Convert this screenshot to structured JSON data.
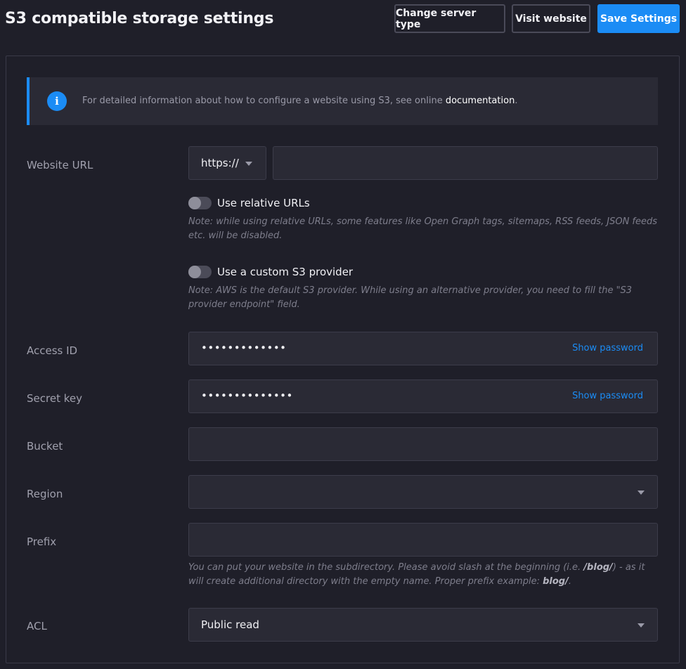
{
  "header": {
    "title": "S3 compatible storage settings",
    "change_server_label": "Change server type",
    "visit_website_label": "Visit website",
    "save_label": "Save Settings"
  },
  "info": {
    "text_before": "For detailed information about how to configure a website using S3, see online ",
    "link_text": "documentation",
    "text_after": "."
  },
  "form": {
    "website_url": {
      "label": "Website URL",
      "protocol": "https://",
      "value": ""
    },
    "relative_urls": {
      "label": "Use relative URLs",
      "enabled": false,
      "note": "Note: while using relative URLs, some features like Open Graph tags, sitemaps, RSS feeds, JSON feeds etc. will be disabled."
    },
    "custom_provider": {
      "label": "Use a custom S3 provider",
      "enabled": false,
      "note": "Note: AWS is the default S3 provider. While using an alternative provider, you need to fill the \"S3 provider endpoint\" field."
    },
    "access_id": {
      "label": "Access ID",
      "masked_value": "•••••••••••••",
      "show_label": "Show password"
    },
    "secret_key": {
      "label": "Secret key",
      "masked_value": "••••••••••••••",
      "show_label": "Show password"
    },
    "bucket": {
      "label": "Bucket",
      "value": ""
    },
    "region": {
      "label": "Region",
      "value": ""
    },
    "prefix": {
      "label": "Prefix",
      "value": "",
      "note_part1": "You can put your website in the subdirectory. Please avoid slash at the beginning (i.e. ",
      "note_bold1": "/blog/",
      "note_part2": ") - as it will create additional directory with the empty name. Proper prefix example: ",
      "note_bold2": "blog/",
      "note_part3": "."
    },
    "acl": {
      "label": "ACL",
      "value": "Public read"
    }
  },
  "colors": {
    "accent": "#1b8cf5",
    "background": "#1f1f29",
    "field": "#2a2a35"
  }
}
